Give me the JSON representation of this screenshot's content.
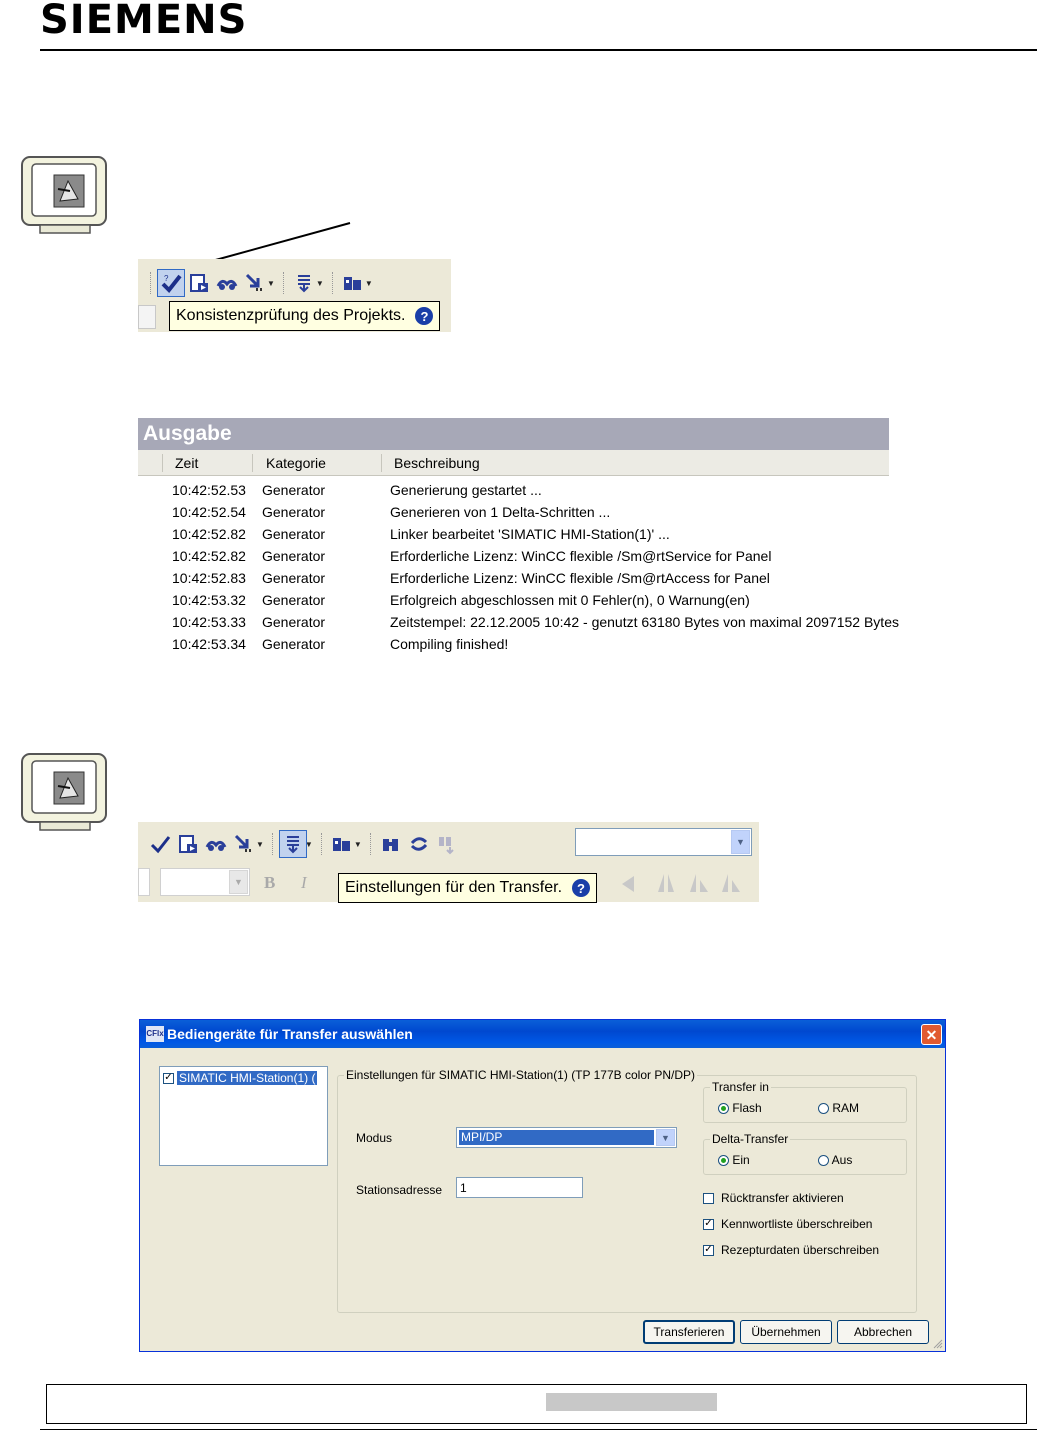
{
  "header": {
    "logo": "SIEMENS"
  },
  "toolbar1": {
    "icons": [
      "check-consistency-icon",
      "compile-icon",
      "simulate-icon",
      "transfer-icon",
      "download-icon",
      "project-icon"
    ],
    "tooltip": "Konsistenzprüfung des Projekts."
  },
  "output": {
    "title": "Ausgabe",
    "columns": [
      "Zeit",
      "Kategorie",
      "Beschreibung"
    ],
    "rows": [
      {
        "time": "10:42:52.53",
        "category": "Generator",
        "description": "Generierung gestartet ..."
      },
      {
        "time": "10:42:52.54",
        "category": "Generator",
        "description": "Generieren von 1 Delta-Schritten ..."
      },
      {
        "time": "10:42:52.82",
        "category": "Generator",
        "description": "Linker bearbeitet 'SIMATIC HMI-Station(1)' ..."
      },
      {
        "time": "10:42:52.82",
        "category": "Generator",
        "description": "Erforderliche Lizenz: WinCC flexible /Sm@rtService for Panel"
      },
      {
        "time": "10:42:52.83",
        "category": "Generator",
        "description": "Erforderliche Lizenz: WinCC flexible /Sm@rtAccess for Panel"
      },
      {
        "time": "10:42:53.32",
        "category": "Generator",
        "description": "Erfolgreich abgeschlossen mit 0 Fehler(n), 0 Warnung(en)"
      },
      {
        "time": "10:42:53.33",
        "category": "Generator",
        "description": "Zeitstempel: 22.12.2005 10:42 - genutzt 63180 Bytes von maximal 2097152 Bytes"
      },
      {
        "time": "10:42:53.34",
        "category": "Generator",
        "description": "Compiling finished!"
      }
    ]
  },
  "toolbar2": {
    "tooltip": "Einstellungen für den Transfer.",
    "bold": "B",
    "italic": "I"
  },
  "dialog": {
    "app_icon": "CFlx",
    "title": "Bediengeräte für Transfer auswählen",
    "devices": [
      "SIMATIC HMI-Station(1) ("
    ],
    "settings_group": "Einstellungen für  SIMATIC HMI-Station(1) (TP 177B  color PN/DP)",
    "mode_label": "Modus",
    "mode_value": "MPI/DP",
    "station_label": "Stationsadresse",
    "station_value": "1",
    "transfer_in": {
      "label": "Transfer in",
      "options": [
        "Flash",
        "RAM"
      ],
      "selected": "Flash"
    },
    "delta_transfer": {
      "label": "Delta-Transfer",
      "options": [
        "Ein",
        "Aus"
      ],
      "selected": "Ein"
    },
    "checks": [
      {
        "label": "Rücktransfer aktivieren",
        "checked": false
      },
      {
        "label": "Kennwortliste überschreiben",
        "checked": true
      },
      {
        "label": "Rezepturdaten überschreiben",
        "checked": true
      }
    ],
    "buttons": {
      "transfer": "Transferieren",
      "apply": "Übernehmen",
      "cancel": "Abbrechen"
    }
  }
}
